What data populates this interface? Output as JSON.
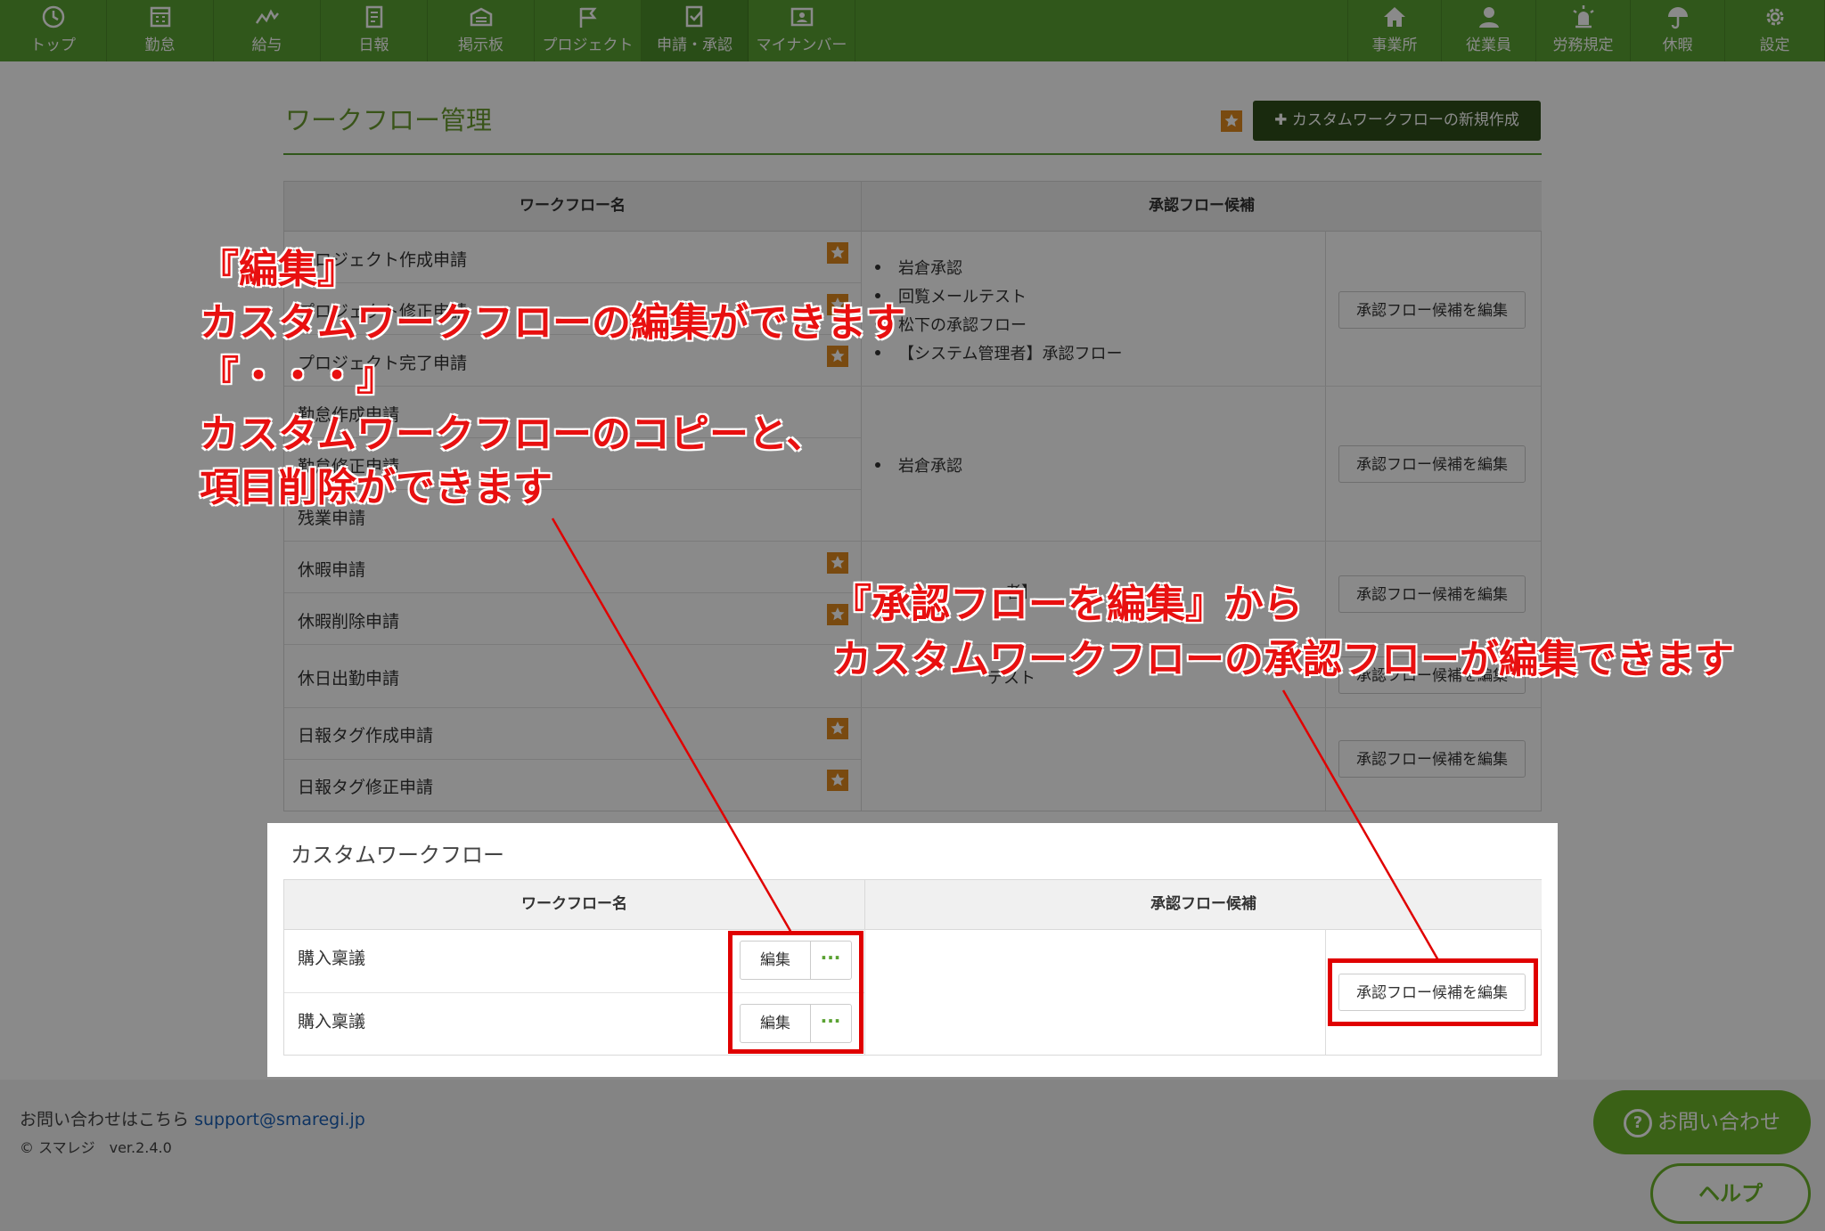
{
  "nav": {
    "left": [
      {
        "label": "トップ",
        "icon": "clock-icon"
      },
      {
        "label": "勤怠",
        "icon": "calendar-icon"
      },
      {
        "label": "給与",
        "icon": "chart-icon"
      },
      {
        "label": "日報",
        "icon": "document-icon"
      },
      {
        "label": "掲示板",
        "icon": "board-icon"
      },
      {
        "label": "プロジェクト",
        "icon": "flag-icon"
      },
      {
        "label": "申請・承認",
        "icon": "approval-icon"
      },
      {
        "label": "マイナンバー",
        "icon": "id-card-icon"
      }
    ],
    "right": [
      {
        "label": "事業所",
        "icon": "home-icon"
      },
      {
        "label": "従業員",
        "icon": "user-icon"
      },
      {
        "label": "労務規定",
        "icon": "alarm-icon"
      },
      {
        "label": "休暇",
        "icon": "umbrella-icon"
      },
      {
        "label": "設定",
        "icon": "gear-icon"
      }
    ]
  },
  "page": {
    "title": "ワークフロー管理",
    "new_button": "✚ カスタムワークフローの新規作成"
  },
  "table": {
    "col_name": "ワークフロー名",
    "col_flow": "承認フロー候補",
    "rows": [
      {
        "name": "プロジェクト作成申請"
      },
      {
        "name": "プロジェクト修正申請"
      },
      {
        "name": "プロジェクト完了申請"
      },
      {
        "name": "勤怠作成申請"
      },
      {
        "name": "勤怠修正申請"
      },
      {
        "name": "残業申請"
      },
      {
        "name": "休暇申請"
      },
      {
        "name": "休暇削除申請"
      },
      {
        "name": "休日出勤申請"
      },
      {
        "name": "日報タグ作成申請"
      },
      {
        "name": "日報タグ修正申請"
      }
    ],
    "group1_flows": [
      "岩倉承認",
      "回覧メールテスト",
      "松下の承認フロー",
      "【システム管理者】承認フロー"
    ],
    "group2_flows": [
      "岩倉承認"
    ],
    "group3_flow_partial": "者】",
    "group4_flow_partial": "テスト",
    "edit_flow_button": "承認フロー候補を編集"
  },
  "custom": {
    "title": "カスタムワークフロー",
    "col_name": "ワークフロー名",
    "col_flow": "承認フロー候補",
    "rows": [
      {
        "name": "購入稟議",
        "edit": "編集",
        "more": "···"
      },
      {
        "name": "購入稟議",
        "edit": "編集",
        "more": "···"
      }
    ],
    "edit_flow_button": "承認フロー候補を編集"
  },
  "footer": {
    "contact_prefix": "お問い合わせはこちら",
    "contact_email": "support@smaregi.jp",
    "copyright": "© スマレジ　ver.2.4.0",
    "contact_button": "お問い合わせ",
    "help_button": "ヘルプ"
  },
  "annotations": {
    "left_1": "『編集』",
    "left_2": "カスタムワークフローの編集ができます",
    "left_3": "『・・・』",
    "left_4": "カスタムワークフローのコピーと、",
    "left_5": "項目削除ができます",
    "right_1": "『承認フローを編集』から",
    "right_2": "カスタムワークフローの承認フローが編集できます"
  },
  "colors": {
    "nav_green": "#5aa232",
    "annotation_red": "#e81010",
    "button_dark": "#2f4f1a"
  }
}
